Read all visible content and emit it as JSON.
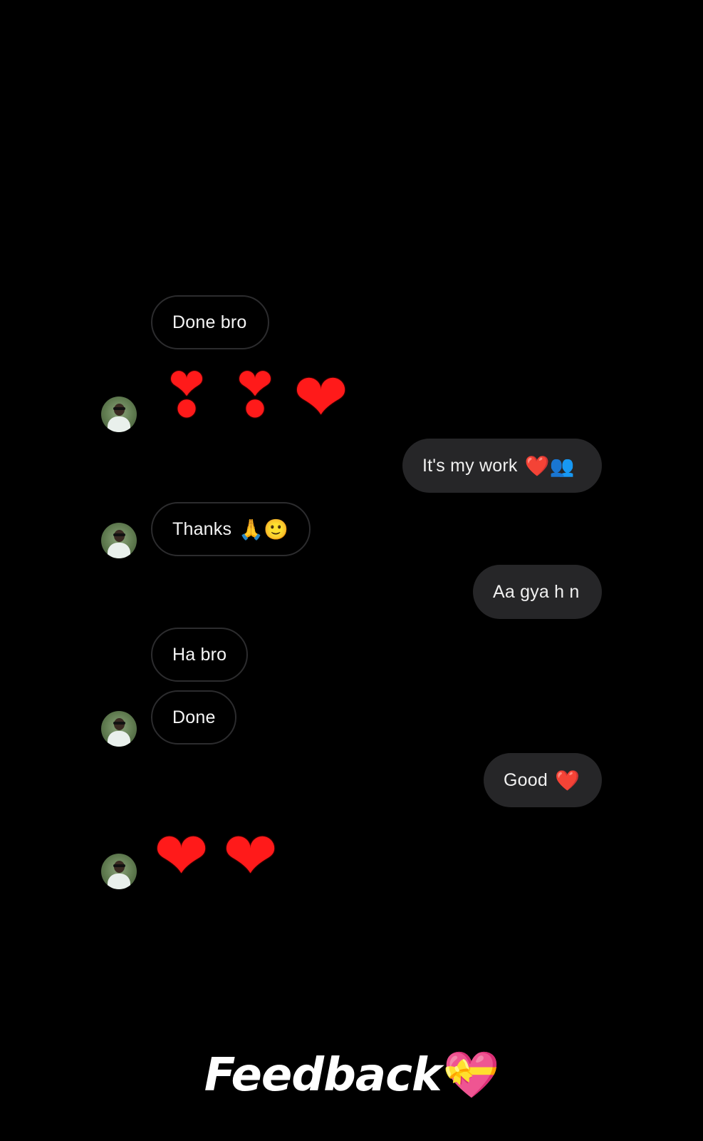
{
  "messages": {
    "m1": {
      "text": "Done bro"
    },
    "m2": {
      "emojis": [
        "❣",
        "❣",
        "❤"
      ]
    },
    "m3": {
      "text": "It's my work",
      "emoji": "❤️👥"
    },
    "m4": {
      "text": "Thanks",
      "emoji": "🙏🙂"
    },
    "m5": {
      "text": "Aa gya h n"
    },
    "m6": {
      "text": "Ha bro"
    },
    "m7": {
      "text": "Done"
    },
    "m8": {
      "text": "Good",
      "emoji": "❤️"
    },
    "m9": {
      "emojis": [
        "❤",
        "❤"
      ]
    }
  },
  "caption": {
    "text": "Feedback",
    "emoji": "💝"
  },
  "colors": {
    "background": "#000000",
    "outgoing_bubble": "#262628",
    "incoming_border": "#2c2c2e",
    "heart": "#ff1a1a"
  },
  "icons": {
    "avatar": "profile-photo",
    "heart": "red-heart",
    "heart_exclamation": "heart-exclamation",
    "gift_heart": "heart-with-ribbon"
  }
}
